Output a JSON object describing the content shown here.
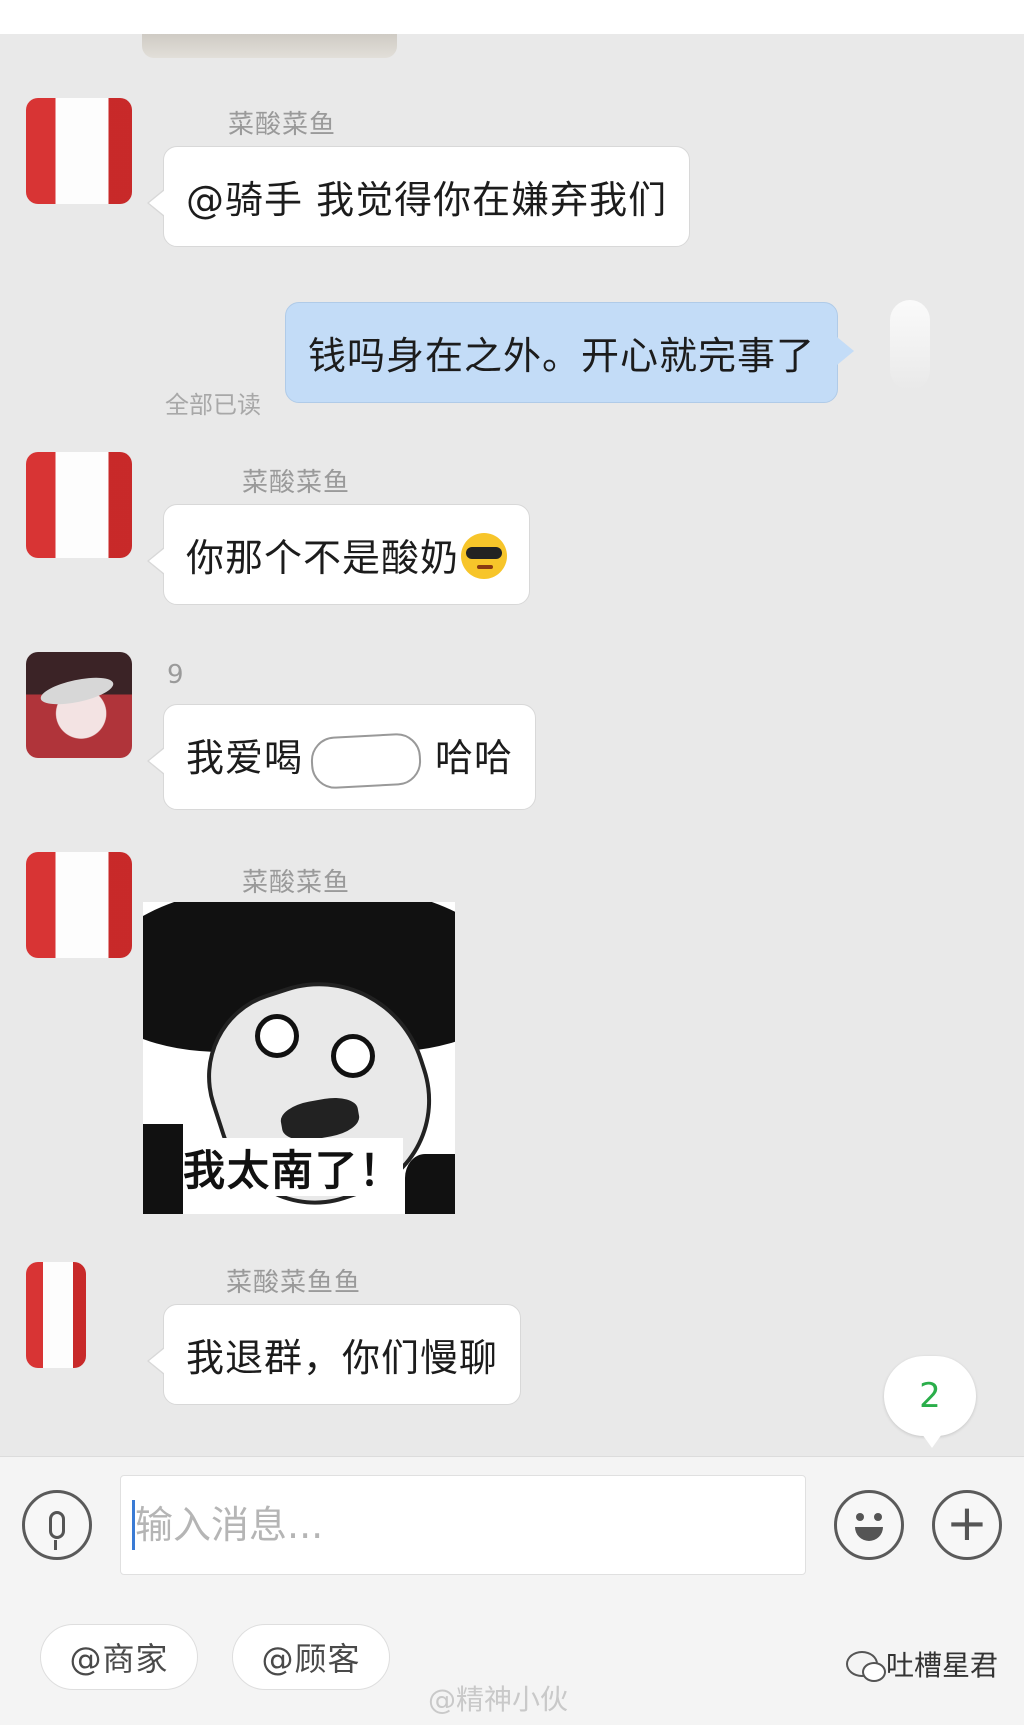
{
  "chat": {
    "messages": [
      {
        "sender": "菜酸菜鱼",
        "text": "@骑手 我觉得你在嫌弃我们"
      },
      {
        "text": "钱吗身在之外。开心就完事了",
        "read_status": "全部已读"
      },
      {
        "sender": "菜酸菜鱼",
        "text": "你那个不是酸奶"
      },
      {
        "sender": "9",
        "text_before": "我爱喝",
        "text_after": "哈哈"
      },
      {
        "sender": "菜酸菜鱼",
        "sticker_caption": "我太南了！"
      },
      {
        "sender": "菜酸菜鱼鱼",
        "text": "我退群，你们慢聊"
      }
    ],
    "unread_count": "2"
  },
  "composer": {
    "placeholder": "输入消息..."
  },
  "quick_mentions": [
    "@商家",
    "@顾客"
  ],
  "watermarks": {
    "weibo": "@精神小伙",
    "wechat": "吐槽星君"
  },
  "colors": {
    "my_bubble": "#c3dcf7",
    "badge_text": "#2aae4a"
  }
}
